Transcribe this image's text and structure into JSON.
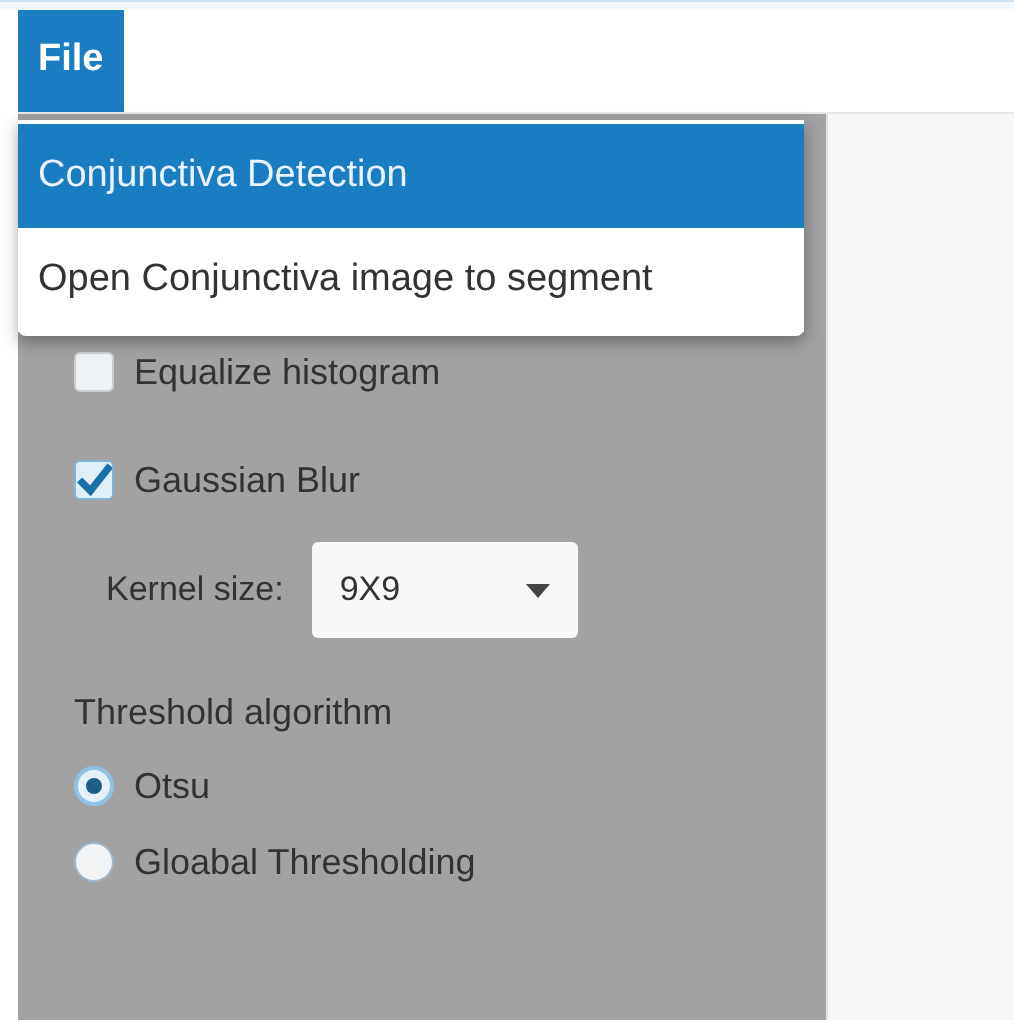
{
  "menu_bar": {
    "items": [
      {
        "label": "File",
        "selected": true
      }
    ]
  },
  "file_menu": {
    "items": [
      {
        "label": "Conjunctiva Detection",
        "selected": true
      },
      {
        "label": "Open Conjunctiva image to segment",
        "selected": false
      }
    ]
  },
  "options": [
    {
      "label": "Equalize histogram",
      "checked": false
    },
    {
      "label": "Gaussian Blur",
      "checked": true
    }
  ],
  "kernel_size": {
    "label": "Kernel size:",
    "value": "9X9"
  },
  "threshold": {
    "title": "Threshold algorithm",
    "choices": [
      {
        "label": "Otsu",
        "selected": true
      },
      {
        "label": "Gloabal Thresholding",
        "selected": false
      }
    ]
  }
}
